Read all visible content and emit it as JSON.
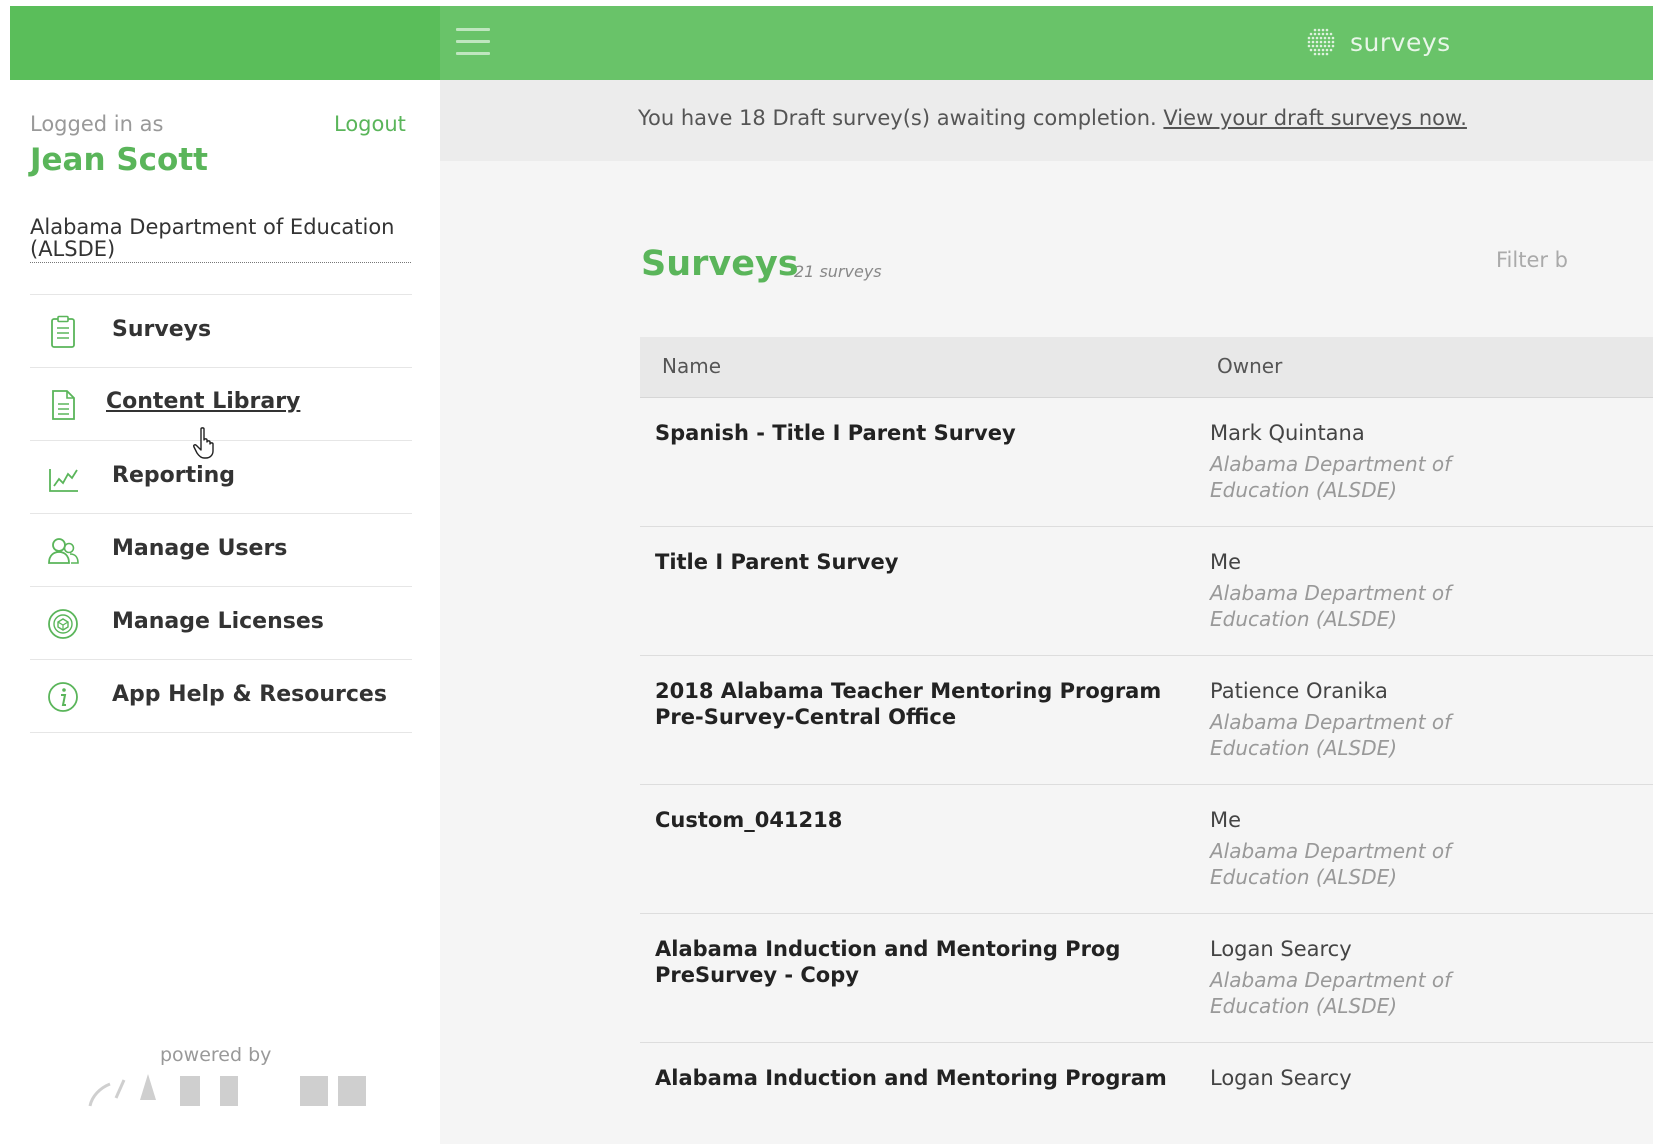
{
  "header": {
    "brand_text": "surveys",
    "brand_icon": "surveys-grid-icon",
    "menu_icon": "hamburger-menu-icon",
    "accent": "#5ab55a"
  },
  "sidebar": {
    "logged_in_label": "Logged in as",
    "logout_label": "Logout",
    "user_name": "Jean Scott",
    "organization": "Alabama Department of Education (ALSDE)",
    "items": [
      {
        "label": "Surveys",
        "icon": "clipboard-icon"
      },
      {
        "label": "Content Library",
        "icon": "document-icon"
      },
      {
        "label": "Reporting",
        "icon": "chart-icon"
      },
      {
        "label": "Manage Users",
        "icon": "users-icon"
      },
      {
        "label": "Manage Licenses",
        "icon": "license-icon"
      },
      {
        "label": "App Help & Resources",
        "icon": "info-icon"
      }
    ],
    "powered_by": "powered by"
  },
  "notice": {
    "text": "You have 18 Draft survey(s) awaiting completion.",
    "link": "View your draft surveys now."
  },
  "main": {
    "title": "Surveys",
    "count": "21 surveys",
    "filter_label": "Filter b",
    "columns": [
      "Name",
      "Owner"
    ],
    "rows": [
      {
        "name": "Spanish - Title I Parent Survey",
        "owner": "Mark Quintana",
        "org": "Alabama Department of Education (ALSDE)"
      },
      {
        "name": "Title I Parent Survey",
        "owner": "Me",
        "org": "Alabama Department of Education (ALSDE)"
      },
      {
        "name": "2018 Alabama Teacher Mentoring Program Pre-Survey-Central Office",
        "owner": "Patience Oranika",
        "org": "Alabama Department of Education (ALSDE)"
      },
      {
        "name": "Custom_041218",
        "owner": "Me",
        "org": "Alabama Department of Education (ALSDE)"
      },
      {
        "name": "Alabama Induction and Mentoring Prog PreSurvey - Copy",
        "owner": "Logan Searcy",
        "org": "Alabama Department of Education (ALSDE)"
      },
      {
        "name": "Alabama Induction and Mentoring Program",
        "owner": "Logan Searcy",
        "org": ""
      }
    ]
  }
}
